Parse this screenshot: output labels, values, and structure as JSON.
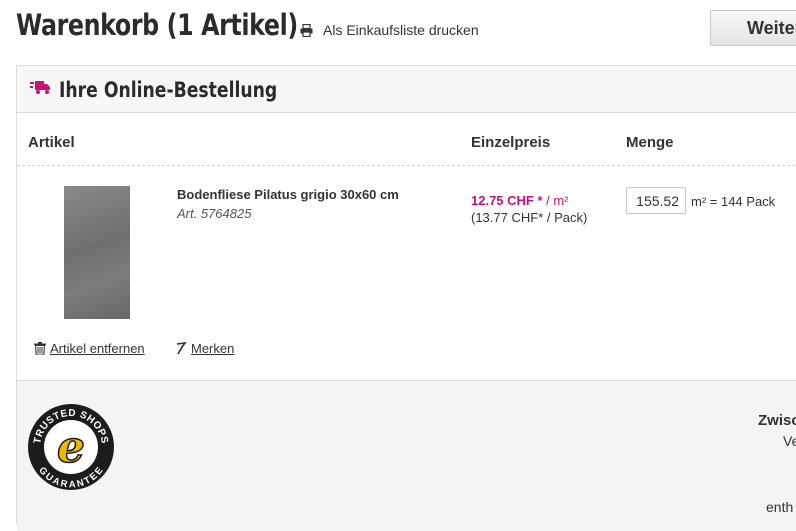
{
  "header": {
    "title": "Warenkorb (1 Artikel)",
    "print_label": "Als Einkaufsliste drucken",
    "continue_label": "Weiter"
  },
  "order": {
    "title": "Ihre Online-Bestellung",
    "columns": {
      "article": "Artikel",
      "unit_price": "Einzelpreis",
      "quantity": "Menge"
    }
  },
  "item": {
    "name": "Bodenfliese Pilatus grigio 30x60 cm",
    "article_no": "Art. 5764825",
    "price_main": "12.75 CHF *",
    "price_unit": "/ m²",
    "price_pack": "(13.77 CHF*  / Pack)",
    "quantity_value": "155.52",
    "quantity_unit": "m² = 144 Pack",
    "remove_label": "Artikel entfernen",
    "save_label": "Merken"
  },
  "summary": {
    "title": "Zwisc",
    "line1": "Ve",
    "footer": "enth"
  },
  "trust_badge": {
    "text_top": "TRUSTED SHOPS",
    "text_bottom": "GUARANTEE",
    "letter": "e"
  },
  "colors": {
    "accent": "#c5137a",
    "text": "#333333",
    "panel_bg": "#f7f7f7"
  },
  "icons": {
    "print": "printer-icon",
    "truck": "delivery-truck-icon",
    "remove": "trash-icon",
    "save": "pin-icon"
  }
}
